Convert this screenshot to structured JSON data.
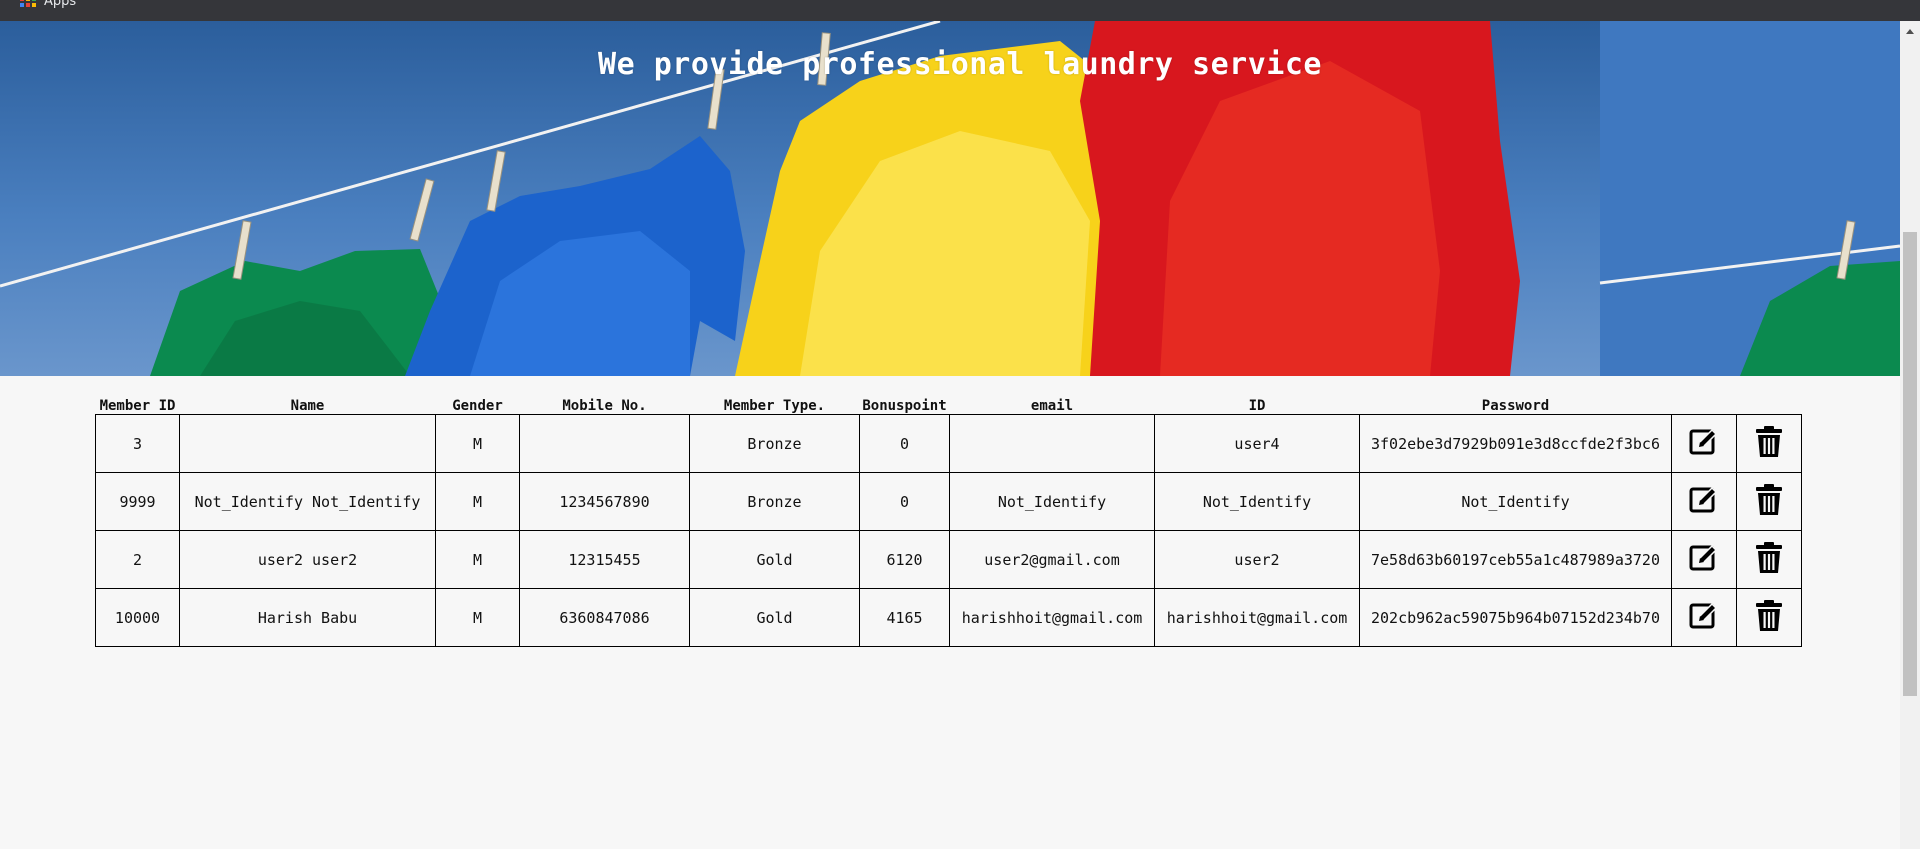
{
  "browser": {
    "apps_label": "Apps"
  },
  "hero": {
    "title": "We provide professional laundry service"
  },
  "table": {
    "headers": [
      "Member ID",
      "Name",
      "Gender",
      "Mobile No.",
      "Member Type.",
      "Bonuspoint",
      "email",
      "ID",
      "Password"
    ],
    "rows": [
      {
        "member_id": "3",
        "name": "",
        "gender": "M",
        "mobile": "",
        "member_type": "Bronze",
        "bonuspoint": "0",
        "email": "",
        "id": "user4",
        "password": "3f02ebe3d7929b091e3d8ccfde2f3bc6"
      },
      {
        "member_id": "9999",
        "name": "Not_Identify Not_Identify",
        "gender": "M",
        "mobile": "1234567890",
        "member_type": "Bronze",
        "bonuspoint": "0",
        "email": "Not_Identify",
        "id": "Not_Identify",
        "password": "Not_Identify"
      },
      {
        "member_id": "2",
        "name": "user2 user2",
        "gender": "M",
        "mobile": "12315455",
        "member_type": "Gold",
        "bonuspoint": "6120",
        "email": "user2@gmail.com",
        "id": "user2",
        "password": "7e58d63b60197ceb55a1c487989a3720"
      },
      {
        "member_id": "10000",
        "name": "Harish Babu",
        "gender": "M",
        "mobile": "6360847086",
        "member_type": "Gold",
        "bonuspoint": "4165",
        "email": "harishhoit@gmail.com",
        "id": "harishhoit@gmail.com",
        "password": "202cb962ac59075b964b07152d234b70"
      }
    ],
    "icons": {
      "edit": "edit-icon",
      "delete": "trash-icon"
    }
  },
  "colors": {
    "background": "#f7f7f7",
    "hero_title": "#ffffff",
    "border": "#000000"
  }
}
